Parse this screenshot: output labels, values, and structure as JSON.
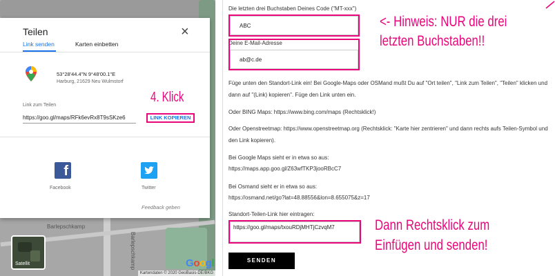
{
  "map": {
    "street_label": "Barlepschkamp",
    "street_label_vertical": "Barlepschkamp",
    "satellite_label": "Satellit",
    "google_letters": [
      "G",
      "o",
      "o",
      "g",
      "l"
    ],
    "attribution": "Kartendaten © 2020 GeoBasis-DE/BKG"
  },
  "dialog": {
    "title": "Teilen",
    "tabs": [
      {
        "label": "Link senden",
        "active": true
      },
      {
        "label": "Karten einbetten",
        "active": false
      }
    ],
    "location": {
      "coords": "53°28'44.4\"N 9°48'00.1\"E",
      "address": "Harburg, 21629 Neu Wulmstorf"
    },
    "link_label": "Link zum Teilen",
    "link_value": "https://goo.gl/maps/RFk6evRx8T9sSKze6",
    "copy_button": "LINK KOPIEREN",
    "annotation": "4. Klick",
    "share": [
      {
        "label": "Facebook",
        "icon": "facebook-icon"
      },
      {
        "label": "Twitter",
        "icon": "twitter-icon"
      }
    ],
    "feedback": "Feedback geben",
    "accent_color": "#1a73e8",
    "highlight_color": "#e8067a"
  },
  "form": {
    "code_label": "Die letzten drei Buchstaben Deines Code (\"MT-xxx\")",
    "code_value": "ABC",
    "email_label": "Deine E-Mail-Adresse",
    "email_value": "ab@c.de",
    "code_note_line1": "<- Hinweis: NUR die drei",
    "code_note_line2": "letzten Buchstaben!!",
    "para1": "Füge unten den Standort-Link ein! Bei Google-Maps oder OSMand mußt Du auf \"Ort teilen\", \"Link zum Teilen\", \"Teilen\" klicken und dann auf \"(Link) kopieren\". Füge den Link unten ein.",
    "para2": "Oder BING Maps: https://www.bing.com/maps (Rechtsklick!)",
    "para3": "Oder Openstreetmap: https://www.openstreetmap.org (Rechtsklick: \"Karte hier zentrieren\" und dann rechts aufs Teilen-Symbol und den Link kopieren).",
    "para4a": "Bei Google Maps sieht er in etwa so aus:",
    "para4b": "https://maps.app.goo.gl/Z63wfTKP3jooRBcC7",
    "para5a": "Bei Osmand sieht er in etwa so aus:",
    "para5b": "https://osmand.net/go?lat=48.88556&lon=8.655075&z=17",
    "link_field_label": "Standort-Teilen-Link hier eintragen:",
    "link_field_value": "https://goo.gl/maps/txouRDjMHTjCzvqM7",
    "link_note_line1": "Dann Rechtsklick zum",
    "link_note_line2": "Einfügen und senden!",
    "submit_label": "SENDEN"
  }
}
